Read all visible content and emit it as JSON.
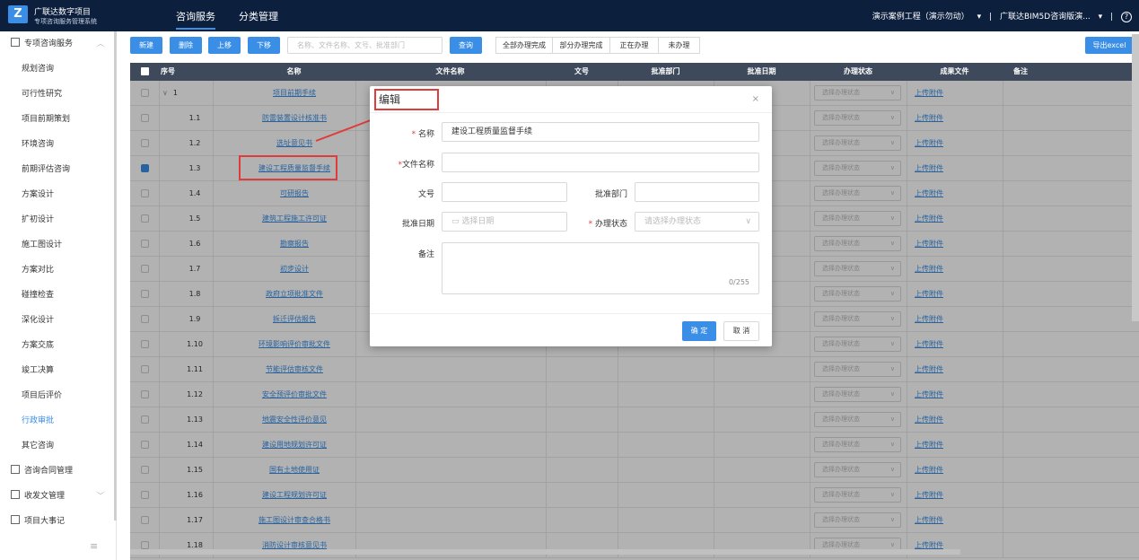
{
  "header": {
    "logo_letter": "Z",
    "brand_title": "广联达数字项目",
    "brand_subtitle": "专项咨询服务管理系统",
    "nav_tabs": [
      "咨询服务",
      "分类管理"
    ],
    "project": "演示案例工程（演示勿动）",
    "project_caret": "▾",
    "separator": "|",
    "org": "广联达BIM5D咨询版演...",
    "help_icon": "?"
  },
  "sidebar": {
    "group1": "专项咨询服务",
    "items": [
      "规划咨询",
      "可行性研究",
      "项目前期策划",
      "环境咨询",
      "前期评估咨询",
      "方案设计",
      "扩初设计",
      "施工图设计",
      "方案对比",
      "碰撞检查",
      "深化设计",
      "方案交底",
      "竣工决算",
      "项目后评价",
      "行政审批",
      "其它咨询"
    ],
    "group2": "咨询合同管理",
    "group3": "收发文管理",
    "group4": "项目大事记",
    "collapse_icon": "≡"
  },
  "toolbar": {
    "new": "新建",
    "delete": "删除",
    "move_up": "上移",
    "move_down": "下移",
    "search_placeholder": "名称、文件名称、文号、批准部门",
    "query": "查询",
    "filters": [
      "全部办理完成",
      "部分办理完成",
      "正在办理",
      "未办理"
    ],
    "export": "导出excel"
  },
  "table": {
    "headers": {
      "index": "序号",
      "name": "名称",
      "file_name": "文件名称",
      "doc_no": "文号",
      "dept": "批准部门",
      "date": "批准日期",
      "status": "办理状态",
      "result": "成果文件",
      "remark": "备注"
    },
    "status_placeholder": "选择办理状态",
    "upload_label": "上传附件",
    "rows": [
      {
        "idx": "1",
        "name": "项目前期手续",
        "expand": "∨"
      },
      {
        "idx": "1.1",
        "name": "防雷装置设计核准书"
      },
      {
        "idx": "1.2",
        "name": "选址意见书"
      },
      {
        "idx": "1.3",
        "name": "建设工程质量监督手续"
      },
      {
        "idx": "1.4",
        "name": "可研报告"
      },
      {
        "idx": "1.5",
        "name": "建筑工程施工许可证"
      },
      {
        "idx": "1.6",
        "name": "勘察报告"
      },
      {
        "idx": "1.7",
        "name": "初步设计"
      },
      {
        "idx": "1.8",
        "name": "政府立项批准文件"
      },
      {
        "idx": "1.9",
        "name": "拆迁评估报告"
      },
      {
        "idx": "1.10",
        "name": "环境影响评价审批文件"
      },
      {
        "idx": "1.11",
        "name": "节能评估审核文件"
      },
      {
        "idx": "1.12",
        "name": "安全预评价审批文件"
      },
      {
        "idx": "1.13",
        "name": "地震安全性评价意见"
      },
      {
        "idx": "1.14",
        "name": "建设用地规划许可证"
      },
      {
        "idx": "1.15",
        "name": "国有土地使用证"
      },
      {
        "idx": "1.16",
        "name": "建设工程规划许可证"
      },
      {
        "idx": "1.17",
        "name": "施工图设计审查合格书"
      },
      {
        "idx": "1.18",
        "name": "消防设计审核意见书"
      }
    ]
  },
  "dialog": {
    "title": "编辑",
    "close_icon": "×",
    "name_label": "名称",
    "name_value": "建设工程质量监督手续",
    "file_label": "文件名称",
    "file_value": "",
    "docno_label": "文号",
    "dept_label": "批准部门",
    "date_label": "批准日期",
    "date_placeholder": "选择日期",
    "calendar_icon": "▭",
    "status_label": "办理状态",
    "status_placeholder": "请选择办理状态",
    "remark_label": "备注",
    "remark_count": "0/255",
    "required_mark": "*",
    "ok": "确 定",
    "cancel": "取 消"
  },
  "colors": {
    "topbar": "#0c1f3d",
    "accent": "#3a8ee6",
    "table_header": "#3e4a5b",
    "annotation_red": "#e03c3c"
  }
}
